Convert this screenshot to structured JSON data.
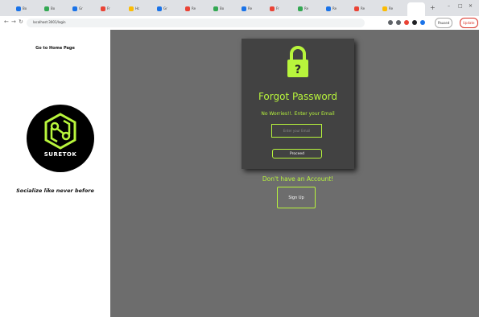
{
  "browser": {
    "tabs": [
      {
        "title": "Bo",
        "color": "#1a73e8"
      },
      {
        "title": "Bo",
        "color": "#34a853"
      },
      {
        "title": "Gr",
        "color": "#1a73e8"
      },
      {
        "title": "Fr",
        "color": "#ea4335"
      },
      {
        "title": "Hc",
        "color": "#fbbc04"
      },
      {
        "title": "Gr",
        "color": "#1a73e8"
      },
      {
        "title": "Re",
        "color": "#ea4335"
      },
      {
        "title": "Bo",
        "color": "#34a853"
      },
      {
        "title": "Re",
        "color": "#1a73e8"
      },
      {
        "title": "Fr",
        "color": "#ea4335"
      },
      {
        "title": "Re",
        "color": "#34a853"
      },
      {
        "title": "Re",
        "color": "#1a73e8"
      },
      {
        "title": "Re",
        "color": "#ea4335"
      },
      {
        "title": "Re",
        "color": "#fbbc04"
      }
    ],
    "url": "localhost:3001/login",
    "paused_label": "Paused",
    "update_label": "Update",
    "accent": "#1a73e8"
  },
  "sidebar": {
    "home_link": "Go to Home Page",
    "logo_text": "SURETOK",
    "tagline": "Socialize like never before"
  },
  "card": {
    "title": "Forgot Password",
    "subtitle": "No Worries!!. Enter your Email",
    "email_placeholder": "Enter your Email",
    "proceed_label": "Proceed"
  },
  "signup": {
    "prompt": "Don't have an Account!",
    "button_label": "Sign Up"
  },
  "colors": {
    "accent": "#b8f53c",
    "panel": "#424242",
    "background": "#6d6d6d"
  }
}
